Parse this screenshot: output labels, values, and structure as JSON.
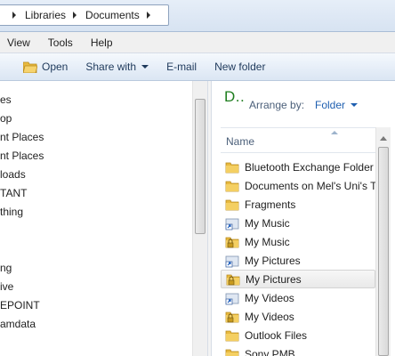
{
  "address": {
    "crumbs": [
      "Libraries",
      "Documents"
    ]
  },
  "menu": {
    "items": [
      "View",
      "Tools",
      "Help"
    ]
  },
  "toolbar": {
    "open": "Open",
    "share": "Share with",
    "email": "E-mail",
    "new_folder": "New folder"
  },
  "nav": {
    "items": [
      "es",
      "op",
      "nt Places",
      "nt Places",
      "loads",
      "TANT",
      "thing",
      "",
      "",
      "ng",
      "ive",
      "EPOINT",
      "amdata"
    ]
  },
  "content": {
    "library_title": "D..",
    "arrange_label": "Arrange by:",
    "arrange_value": "Folder",
    "column_name": "Name",
    "files": [
      {
        "name": "Bluetooth Exchange Folder",
        "icon": "folder-icon"
      },
      {
        "name": "Documents on Mel's Uni's T",
        "icon": "folder-icon"
      },
      {
        "name": "Fragments",
        "icon": "folder-icon"
      },
      {
        "name": "My Music",
        "icon": "shortcut-folder-icon"
      },
      {
        "name": "My Music",
        "icon": "locked-folder-icon"
      },
      {
        "name": "My Pictures",
        "icon": "shortcut-folder-icon"
      },
      {
        "name": "My Pictures",
        "icon": "locked-folder-icon",
        "selected": true
      },
      {
        "name": "My Videos",
        "icon": "shortcut-folder-icon"
      },
      {
        "name": "My Videos",
        "icon": "locked-folder-icon"
      },
      {
        "name": "Outlook Files",
        "icon": "folder-icon"
      },
      {
        "name": "Sony PMB",
        "icon": "folder-icon"
      }
    ]
  },
  "colors": {
    "accent": "#1e7d1e",
    "link": "#1e5fb0",
    "folder": "#e8b93f"
  }
}
